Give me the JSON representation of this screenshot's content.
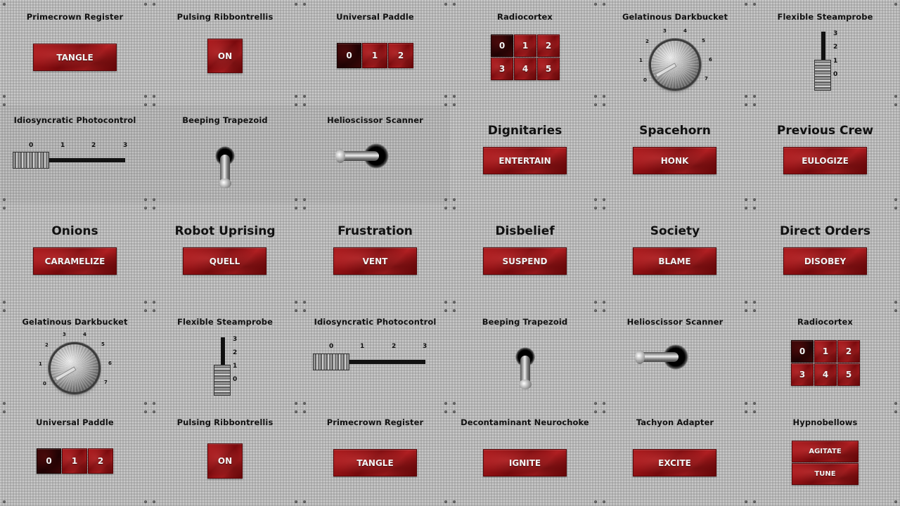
{
  "row1": {
    "primecrown_register": {
      "title": "Primecrown Register",
      "button": "TANGLE"
    },
    "pulsing_ribbontrellis": {
      "title": "Pulsing Ribbontrellis",
      "button": "ON"
    },
    "universal_paddle": {
      "title": "Universal Paddle",
      "options": [
        "0",
        "1",
        "2"
      ],
      "selected": "0"
    },
    "radiocortex": {
      "title": "Radiocortex",
      "options": [
        "0",
        "1",
        "2",
        "3",
        "4",
        "5"
      ],
      "selected": "0"
    },
    "gelatinous_darkbucket": {
      "title": "Gelatinous Darkbucket",
      "labels": [
        "0",
        "1",
        "2",
        "3",
        "4",
        "5",
        "6",
        "7"
      ],
      "value": 0
    },
    "flexible_steamprobe": {
      "title": "Flexible Steamprobe",
      "labels": [
        "3",
        "2",
        "1",
        "0"
      ],
      "value": 0
    }
  },
  "row2": {
    "idiosyncratic_photocontrol": {
      "title": "Idiosyncratic Photocontrol",
      "labels": [
        "0",
        "1",
        "2",
        "3"
      ],
      "value": 0
    },
    "beeping_trapezoid": {
      "title": "Beeping Trapezoid"
    },
    "helioscissor_scanner": {
      "title": "Helioscissor Scanner"
    },
    "dignitaries": {
      "title": "Dignitaries",
      "button": "ENTERTAIN"
    },
    "spacehorn": {
      "title": "Spacehorn",
      "button": "HONK"
    },
    "previous_crew": {
      "title": "Previous Crew",
      "button": "EULOGIZE"
    }
  },
  "row3": {
    "onions": {
      "title": "Onions",
      "button": "CARAMELIZE"
    },
    "robot_uprising": {
      "title": "Robot Uprising",
      "button": "QUELL"
    },
    "frustration": {
      "title": "Frustration",
      "button": "VENT"
    },
    "disbelief": {
      "title": "Disbelief",
      "button": "SUSPEND"
    },
    "society": {
      "title": "Society",
      "button": "BLAME"
    },
    "direct_orders": {
      "title": "Direct Orders",
      "button": "DISOBEY"
    }
  },
  "row4": {
    "gelatinous_darkbucket": {
      "title": "Gelatinous Darkbucket",
      "labels": [
        "0",
        "1",
        "2",
        "3",
        "4",
        "5",
        "6",
        "7"
      ],
      "value": 0
    },
    "flexible_steamprobe": {
      "title": "Flexible Steamprobe",
      "labels": [
        "3",
        "2",
        "1",
        "0"
      ],
      "value": 0
    },
    "idiosyncratic_photocontrol": {
      "title": "Idiosyncratic Photocontrol",
      "labels": [
        "0",
        "1",
        "2",
        "3"
      ],
      "value": 0
    },
    "beeping_trapezoid": {
      "title": "Beeping Trapezoid"
    },
    "helioscissor_scanner": {
      "title": "Helioscissor Scanner"
    },
    "radiocortex": {
      "title": "Radiocortex",
      "options": [
        "0",
        "1",
        "2",
        "3",
        "4",
        "5"
      ],
      "selected": "0"
    }
  },
  "row5": {
    "universal_paddle": {
      "title": "Universal Paddle",
      "options": [
        "0",
        "1",
        "2"
      ],
      "selected": "0"
    },
    "pulsing_ribbontrellis": {
      "title": "Pulsing Ribbontrellis",
      "button": "ON"
    },
    "primecrown_register": {
      "title": "Primecrown Register",
      "button": "TANGLE"
    },
    "decontaminant_neurochoke": {
      "title": "Decontaminant Neurochoke",
      "button": "IGNITE"
    },
    "tachyon_adapter": {
      "title": "Tachyon Adapter",
      "button": "EXCITE"
    },
    "hypnobellows": {
      "title": "Hypnobellows",
      "buttons": [
        "AGITATE",
        "TUNE"
      ]
    }
  }
}
